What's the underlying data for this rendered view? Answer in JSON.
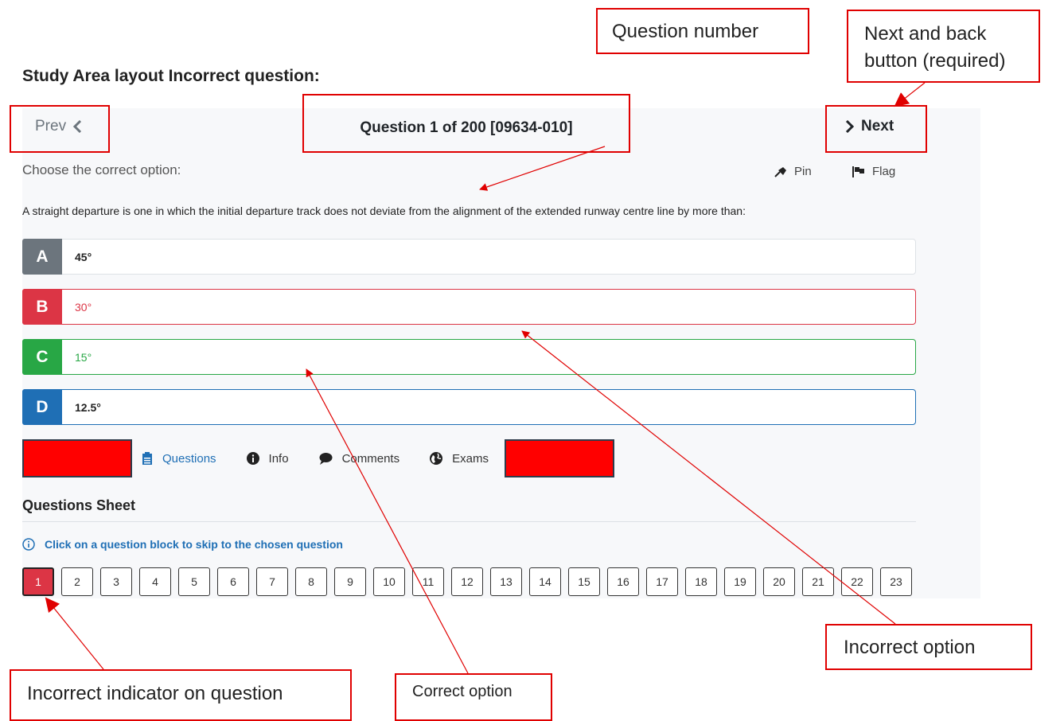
{
  "heading": "Study Area layout Incorrect question:",
  "nav": {
    "prev_label": "Prev",
    "next_label": "Next",
    "question_title": "Question 1 of 200 [09634-010]"
  },
  "instruction": "Choose the correct option:",
  "tools": {
    "pin_label": "Pin",
    "flag_label": "Flag"
  },
  "question_text": "A straight departure is one in which the initial departure track does not deviate from the alignment of the extended runway centre line by more than:",
  "options": [
    {
      "letter": "A",
      "text": "45°",
      "state": "neutral",
      "color": "#6c757d"
    },
    {
      "letter": "B",
      "text": "30°",
      "state": "incorrect",
      "color": "#dc3545"
    },
    {
      "letter": "C",
      "text": "15°",
      "state": "correct",
      "color": "#28a745"
    },
    {
      "letter": "D",
      "text": "12.5°",
      "state": "selected",
      "color": "#1f6fb5"
    }
  ],
  "tabs": {
    "questions": "Questions",
    "info": "Info",
    "comments": "Comments",
    "exams": "Exams"
  },
  "sheet": {
    "title": "Questions Sheet",
    "hint": "Click on a question block to skip to the chosen question",
    "blocks": [
      "1",
      "2",
      "3",
      "4",
      "5",
      "6",
      "7",
      "8",
      "9",
      "10",
      "11",
      "12",
      "13",
      "14",
      "15",
      "16",
      "17",
      "18",
      "19",
      "20",
      "21",
      "22",
      "23"
    ]
  },
  "annotations": {
    "question_number": "Question number",
    "next_back": "Next and back button (required)",
    "incorrect_option": "Incorrect option",
    "correct_option": "Correct option",
    "incorrect_indicator": "Incorrect indicator on question"
  },
  "colors": {
    "annotation": "#e00000",
    "incorrect": "#dc3545",
    "correct": "#28a745",
    "accent": "#1f6fb5"
  }
}
